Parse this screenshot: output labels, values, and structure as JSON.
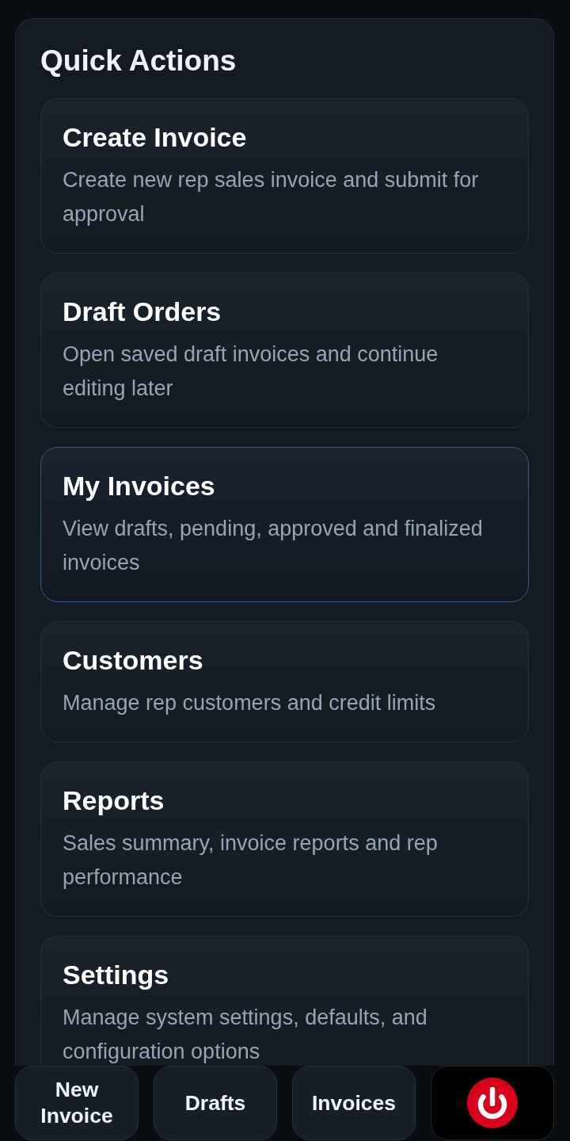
{
  "section": {
    "title": "Quick Actions",
    "cards": [
      {
        "title": "Create Invoice",
        "description": "Create new rep sales invoice and submit for approval",
        "selected": false
      },
      {
        "title": "Draft Orders",
        "description": "Open saved draft invoices and continue editing later",
        "selected": false
      },
      {
        "title": "My Invoices",
        "description": "View drafts, pending, approved and finalized invoices",
        "selected": true
      },
      {
        "title": "Customers",
        "description": "Manage rep customers and credit limits",
        "selected": false
      },
      {
        "title": "Reports",
        "description": "Sales summary, invoice reports and rep performance",
        "selected": false
      },
      {
        "title": "Settings",
        "description": "Manage system settings, defaults, and configuration options",
        "selected": false
      }
    ]
  },
  "bottom_nav": [
    {
      "kind": "label",
      "label": "New Invoice"
    },
    {
      "kind": "label",
      "label": "Drafts"
    },
    {
      "kind": "label",
      "label": "Invoices"
    },
    {
      "kind": "power"
    }
  ]
}
